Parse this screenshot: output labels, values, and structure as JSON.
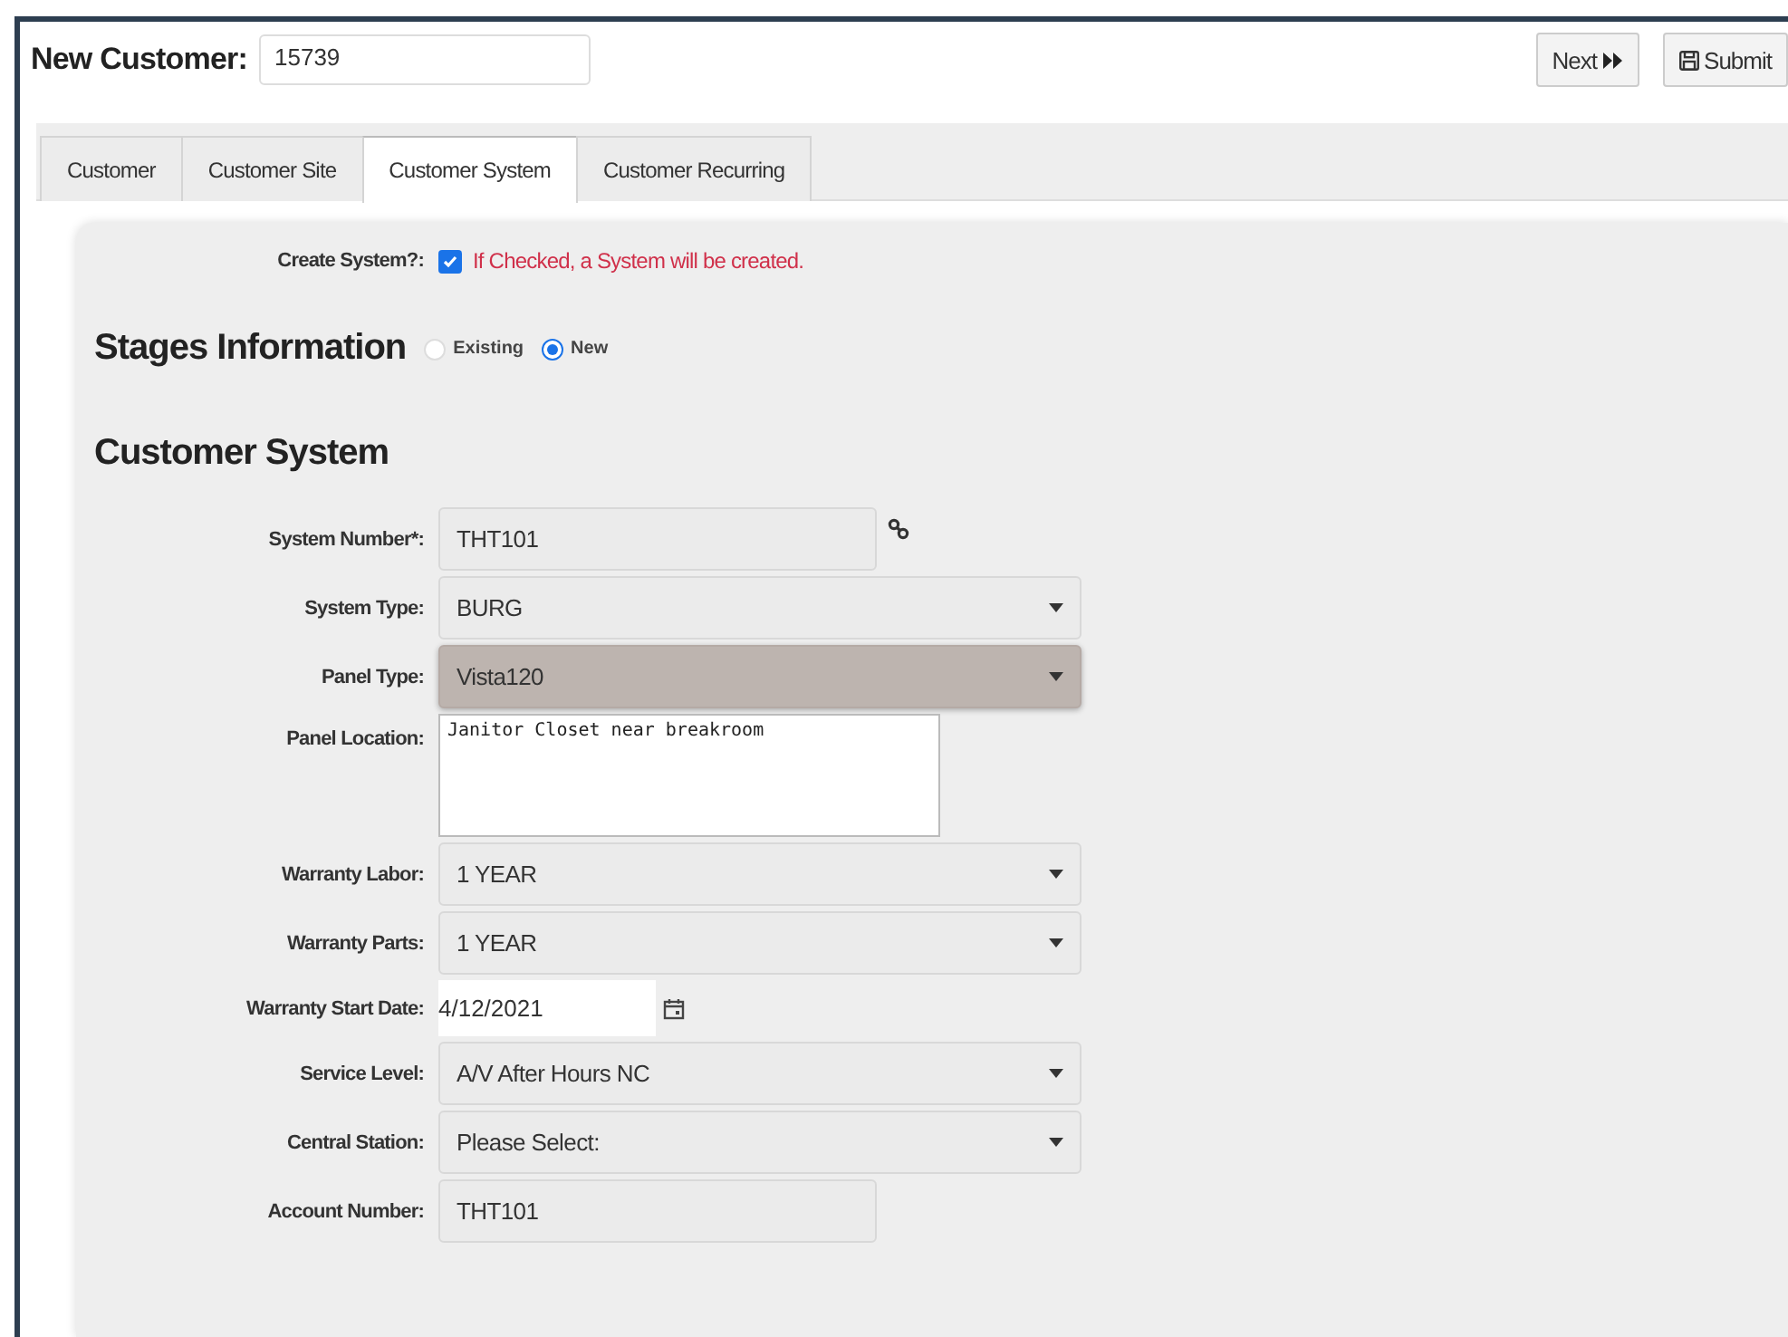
{
  "header": {
    "title": "New Customer:",
    "customer_number": "15739"
  },
  "buttons": [
    {
      "label": "Next",
      "kind": "next"
    },
    {
      "label": "Submit",
      "kind": "submit"
    }
  ],
  "tabs": [
    {
      "label": "Customer",
      "selected": false
    },
    {
      "label": "Customer Site",
      "selected": false
    },
    {
      "label": "Customer System",
      "selected": true
    },
    {
      "label": "Customer Recurring",
      "selected": false
    }
  ],
  "create_system": {
    "label": "Create System?:",
    "checked": true,
    "note": "If Checked, a System will be created."
  },
  "stages": {
    "heading": "Stages Information",
    "options": [
      {
        "label": "Existing",
        "selected": false
      },
      {
        "label": "New",
        "selected": true
      }
    ]
  },
  "section_heading": "Customer System",
  "fields": [
    {
      "label": "System Number*:",
      "kind": "lookup",
      "value": "THT101",
      "highlighted": false
    },
    {
      "label": "System Type:",
      "kind": "select",
      "value": "BURG",
      "highlighted": false
    },
    {
      "label": "Panel Type:",
      "kind": "select",
      "value": "Vista120",
      "highlighted": true
    },
    {
      "label": "Panel Location:",
      "kind": "textarea",
      "value": "Janitor Closet near breakroom",
      "highlighted": false
    },
    {
      "label": "Warranty Labor:",
      "kind": "select",
      "value": "1 YEAR",
      "highlighted": false
    },
    {
      "label": "Warranty Parts:",
      "kind": "select",
      "value": "1 YEAR",
      "highlighted": false
    },
    {
      "label": "Warranty Start Date:",
      "kind": "date",
      "value": "4/12/2021",
      "highlighted": false
    },
    {
      "label": "Service Level:",
      "kind": "select",
      "value": "A/V After Hours NC",
      "highlighted": false
    },
    {
      "label": "Central Station:",
      "kind": "select",
      "value": "Please Select:",
      "highlighted": false
    },
    {
      "label": "Account Number:",
      "kind": "text",
      "value": "THT101",
      "highlighted": false
    }
  ]
}
